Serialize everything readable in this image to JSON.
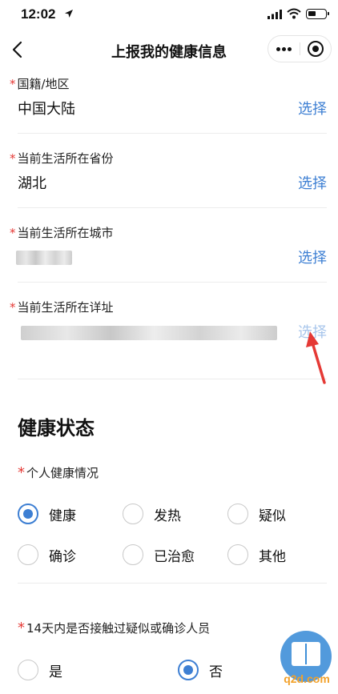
{
  "status_bar": {
    "time": "12:02"
  },
  "nav": {
    "title": "上报我的健康信息"
  },
  "fields": [
    {
      "label": "国籍/地区",
      "value": "中国大陆",
      "action": "选择"
    },
    {
      "label": "当前生活所在省份",
      "value": "湖北",
      "action": "选择"
    },
    {
      "label": "当前生活所在城市",
      "value": "",
      "action": "选择"
    },
    {
      "label": "当前生活所在详址",
      "value": "",
      "action": "选择"
    }
  ],
  "health_section": {
    "title": "健康状态",
    "question1": {
      "label": "个人健康情况",
      "options": [
        "健康",
        "发热",
        "疑似",
        "确诊",
        "已治愈",
        "其他"
      ],
      "selected": "健康"
    },
    "question2": {
      "label": "14天内是否接触过疑似或确诊人员",
      "options": [
        "是",
        "否"
      ],
      "selected": "否"
    }
  },
  "required_mark": "*",
  "watermark": {
    "text": "q2d.com"
  },
  "colors": {
    "accent": "#3d7fd3",
    "required": "#e53935",
    "annotation": "#e53935"
  }
}
